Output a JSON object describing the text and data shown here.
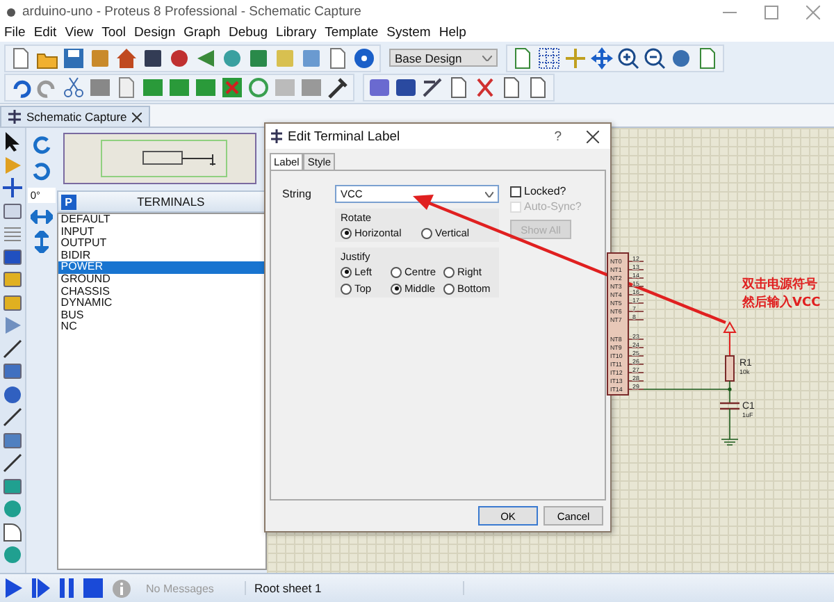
{
  "window": {
    "title": "arduino-uno - Proteus 8 Professional - Schematic Capture"
  },
  "menu": [
    "File",
    "Edit",
    "View",
    "Tool",
    "Design",
    "Graph",
    "Debug",
    "Library",
    "Template",
    "System",
    "Help"
  ],
  "toolbar": {
    "design_select": "Base Design"
  },
  "doc_tab": {
    "label": "Schematic Capture"
  },
  "rotation_field": "0°",
  "library_panel": {
    "pick_button": "P",
    "title": "TERMINALS",
    "items": [
      {
        "label": "DEFAULT",
        "selected": false
      },
      {
        "label": "INPUT",
        "selected": false
      },
      {
        "label": "OUTPUT",
        "selected": false
      },
      {
        "label": "BIDIR",
        "selected": false
      },
      {
        "label": "POWER",
        "selected": true
      },
      {
        "label": "GROUND",
        "selected": false
      },
      {
        "label": "CHASSIS",
        "selected": false
      },
      {
        "label": "DYNAMIC",
        "selected": false
      },
      {
        "label": "BUS",
        "selected": false
      },
      {
        "label": "NC",
        "selected": false
      }
    ]
  },
  "schematic": {
    "pins": [
      {
        "label": "NT0",
        "number": "12"
      },
      {
        "label": "NT1",
        "number": "13"
      },
      {
        "label": "NT2",
        "number": "14"
      },
      {
        "label": "NT3",
        "number": "15"
      },
      {
        "label": "NT4",
        "number": "16"
      },
      {
        "label": "NT5",
        "number": "17"
      },
      {
        "label": "NT6",
        "number": "7"
      },
      {
        "label": "NT7",
        "number": "8"
      },
      {
        "label": "NT8",
        "number": "23"
      },
      {
        "label": "NT9",
        "number": "24"
      },
      {
        "label": "IT10",
        "number": "25"
      },
      {
        "label": "IT11",
        "number": "26"
      },
      {
        "label": "IT12",
        "number": "27"
      },
      {
        "label": "IT13",
        "number": "28"
      },
      {
        "label": "IT14",
        "number": "29"
      }
    ],
    "resistor": {
      "ref": "R1",
      "value": "10k"
    },
    "capacitor": {
      "ref": "C1",
      "value": "1uF"
    },
    "annotation": [
      "双击电源符号",
      "然后输入VCC"
    ]
  },
  "dialog": {
    "title": "Edit Terminal Label",
    "help": "?",
    "tabs": [
      {
        "label": "Label",
        "selected": true
      },
      {
        "label": "Style",
        "selected": false
      }
    ],
    "string_label": "String",
    "string_value": "VCC",
    "locked": {
      "label": "Locked?",
      "checked": false,
      "disabled": false
    },
    "auto_sync": {
      "label": "Auto-Sync?",
      "checked": false,
      "disabled": true
    },
    "show_all": {
      "label": "Show All",
      "disabled": true
    },
    "rotate": {
      "title": "Rotate",
      "options": [
        {
          "label": "Horizontal",
          "selected": true
        },
        {
          "label": "Vertical",
          "selected": false
        }
      ]
    },
    "justify": {
      "title": "Justify",
      "options": [
        {
          "label": "Left",
          "selected": true
        },
        {
          "label": "Centre",
          "selected": false
        },
        {
          "label": "Right",
          "selected": false
        },
        {
          "label": "Top",
          "selected": false
        },
        {
          "label": "Middle",
          "selected": true
        },
        {
          "label": "Bottom",
          "selected": false
        }
      ]
    },
    "buttons": [
      {
        "label": "OK",
        "default": true
      },
      {
        "label": "Cancel",
        "default": false
      }
    ]
  },
  "status_bar": {
    "messages": "No Messages",
    "sheet": "Root sheet 1"
  }
}
